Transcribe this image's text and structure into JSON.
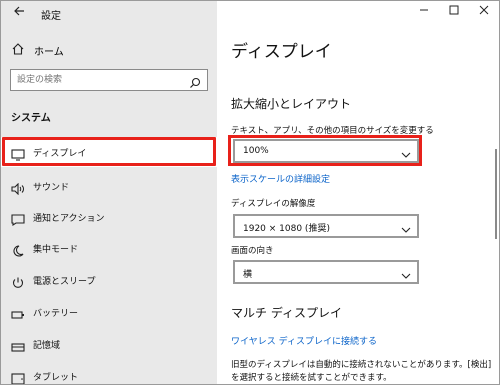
{
  "window": {
    "title": "設定"
  },
  "sidebar": {
    "home_label": "ホーム",
    "search_placeholder": "設定の検索",
    "section": "システム",
    "items": [
      {
        "label": "ディスプレイ",
        "icon": "monitor-icon",
        "selected": true
      },
      {
        "label": "サウンド",
        "icon": "speaker-icon"
      },
      {
        "label": "通知とアクション",
        "icon": "notification-icon"
      },
      {
        "label": "集中モード",
        "icon": "moon-icon"
      },
      {
        "label": "電源とスリープ",
        "icon": "power-icon"
      },
      {
        "label": "バッテリー",
        "icon": "battery-icon"
      },
      {
        "label": "記憶域",
        "icon": "storage-icon"
      },
      {
        "label": "タブレット",
        "icon": "tablet-icon"
      }
    ]
  },
  "main": {
    "title": "ディスプレイ",
    "scale_section": "拡大縮小とレイアウト",
    "scale_label": "テキスト、アプリ、その他の項目のサイズを変更する",
    "scale_value": "100%",
    "scale_link": "表示スケールの詳細設定",
    "resolution_label": "ディスプレイの解像度",
    "resolution_value": "1920 × 1080 (推奨)",
    "orientation_label": "画面の向き",
    "orientation_value": "横",
    "multi_section": "マルチ ディスプレイ",
    "wireless_link": "ワイヤレス ディスプレイに接続する",
    "info_text": "旧型のディスプレイは自動的に接続されないことがあります。[検出] を選択すると接続を試すことができます。"
  },
  "colors": {
    "accent_link": "#0a63c9",
    "highlight": "#e8211a",
    "sidebar_bg": "#e9e9e9"
  }
}
